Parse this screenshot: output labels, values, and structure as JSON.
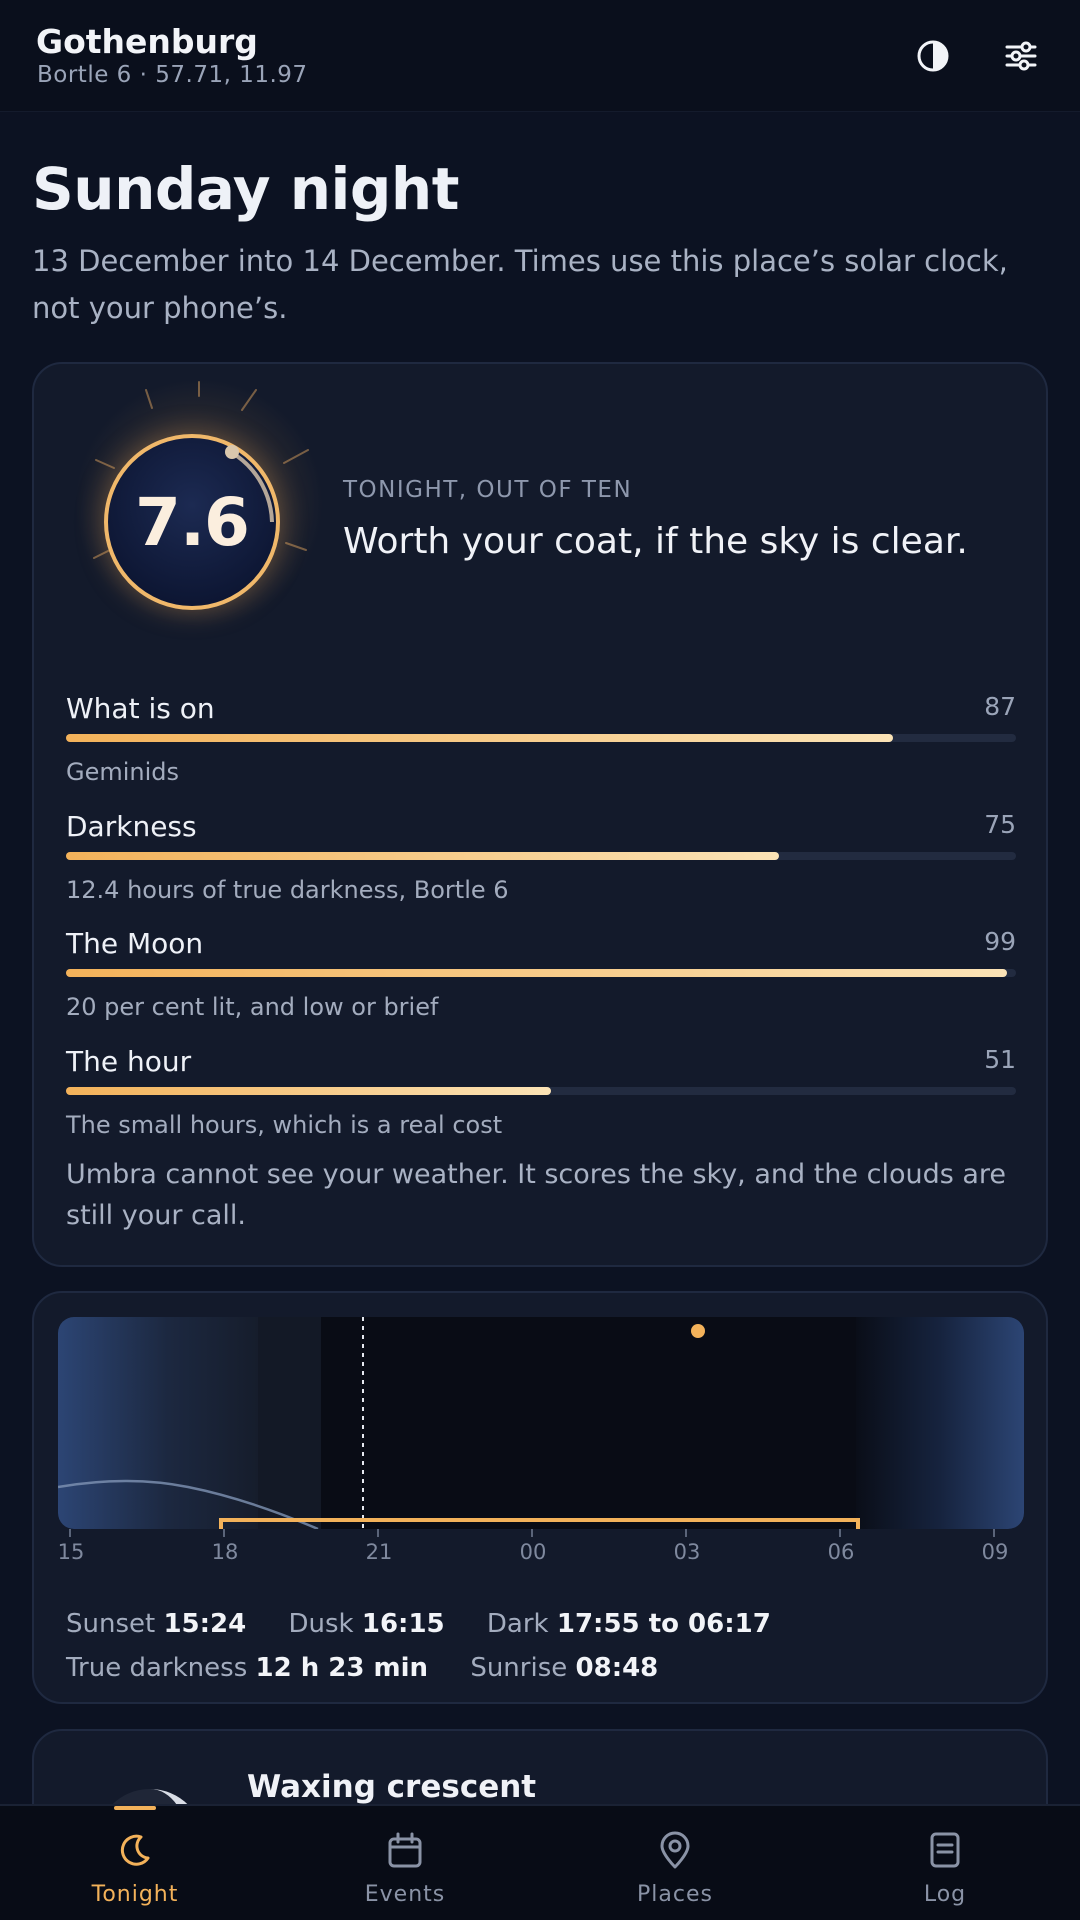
{
  "header": {
    "location_name": "Gothenburg",
    "location_detail": "Bortle 6 · 57.71, 11.97",
    "icons": [
      "contrast-icon",
      "sliders-icon"
    ]
  },
  "page": {
    "title": "Sunday night",
    "intro": "13 December into 14 December. Times use this place’s solar clock, not your phone’s."
  },
  "score": {
    "value": "7.6",
    "label": "TONIGHT, OUT OF TEN",
    "summary": "Worth your coat, if the sky is clear.",
    "factors": [
      {
        "name": "What is on",
        "score": "87",
        "level": 87,
        "note": "Geminids"
      },
      {
        "name": "Darkness",
        "score": "75",
        "level": 75,
        "note": "12.4 hours of true darkness, Bortle 6"
      },
      {
        "name": "The Moon",
        "score": "99",
        "level": 99,
        "note": "20 per cent lit, and low or brief"
      },
      {
        "name": "The hour",
        "score": "51",
        "level": 51,
        "note": "The small hours, which is a real cost"
      }
    ],
    "disclaimer": "Umbra cannot see your weather. It scores the sky, and the clouds are still your call."
  },
  "night": {
    "hours": [
      "15",
      "18",
      "21",
      "00",
      "03",
      "06",
      "09"
    ],
    "stats": {
      "sunset_label": "Sunset",
      "sunset": "15:24",
      "dusk_label": "Dusk",
      "dusk": "16:15",
      "dark_label": "Dark",
      "dark": "17:55 to 06:17",
      "true_dark_label": "True darkness",
      "true_dark": "12 h 23 min",
      "sunrise_label": "Sunrise",
      "sunrise": "08:48"
    }
  },
  "moon": {
    "phase": "Waxing crescent"
  },
  "nav": [
    {
      "label": "Tonight",
      "icon": "moon-icon",
      "active": true
    },
    {
      "label": "Events",
      "icon": "calendar-icon",
      "active": false
    },
    {
      "label": "Places",
      "icon": "map-pin-icon",
      "active": false
    },
    {
      "label": "Log",
      "icon": "journal-icon",
      "active": false
    }
  ],
  "colors": {
    "accent": "#f3b25a",
    "background": "#0c1222",
    "card": "#131a2b"
  }
}
